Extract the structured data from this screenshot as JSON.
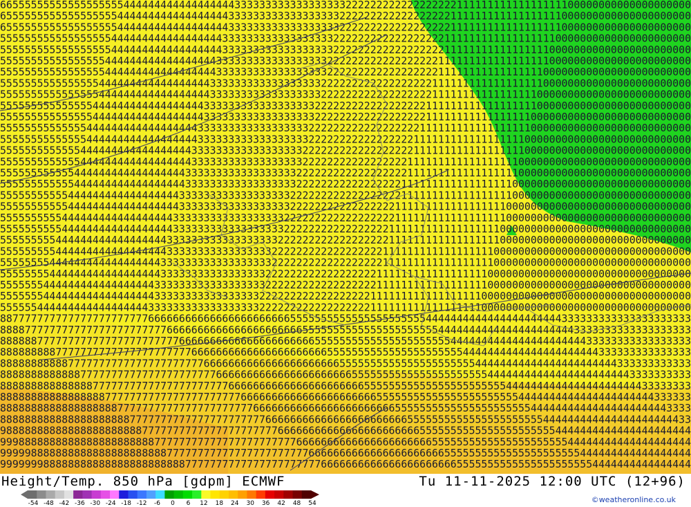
{
  "map": {
    "title": "Height/Temp. 850 hPa [gdpm] ECMWF",
    "valid_time": "Tu 11-11-2025 12:00 UTC (12+96)",
    "credit": "©weatheronline.co.uk",
    "colors": {
      "background_yellow": "#f6ef24",
      "orange": "#f2bd2c",
      "dark_orange": "#efad2c",
      "green_zone": "#1fd41f",
      "contour": "#3c3c64",
      "border": "#777777"
    },
    "temperature_legend": {
      "ticks": [
        "-54",
        "-48",
        "-42",
        "-36",
        "-30",
        "-24",
        "-18",
        "-12",
        "-6",
        "0",
        "6",
        "12",
        "18",
        "24",
        "30",
        "36",
        "42",
        "48",
        "54"
      ],
      "colors": [
        "#6e6e6e",
        "#8c8c8c",
        "#aaaaaa",
        "#c8c8c8",
        "#e1e1e1",
        "#8c2896",
        "#a032b4",
        "#c83cd2",
        "#e650e6",
        "#ff78ff",
        "#1e1edc",
        "#2850f0",
        "#3c78ff",
        "#50a0ff",
        "#3cdcff",
        "#00a000",
        "#00be00",
        "#00dc00",
        "#28f028",
        "#fafa28",
        "#ffe600",
        "#ffd200",
        "#ffbe00",
        "#ffa000",
        "#ff7800",
        "#ff3c00",
        "#e60000",
        "#c80000",
        "#a00000",
        "#780000",
        "#500000"
      ]
    }
  }
}
